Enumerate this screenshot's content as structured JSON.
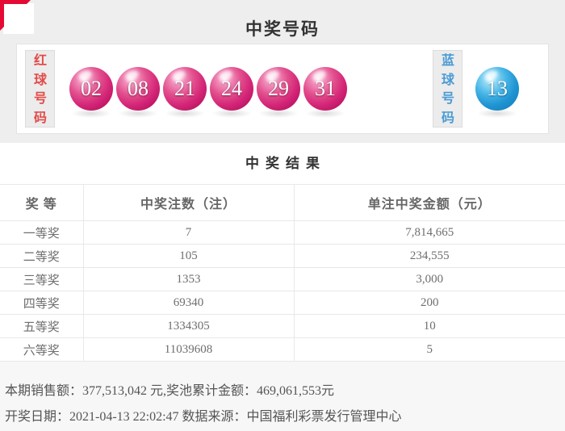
{
  "header": {
    "title": "中奖号码"
  },
  "balls": {
    "red_label": "红球号码",
    "blue_label": "蓝球号码",
    "red": [
      "02",
      "08",
      "21",
      "24",
      "29",
      "31"
    ],
    "blue_value": "13"
  },
  "colors": {
    "accent_corner_red": "#e50a33",
    "red_ball": "#d42577",
    "blue_ball": "#1f94d2",
    "red_label_text": "#e34a48",
    "blue_label_text": "#4a9bd5"
  },
  "results": {
    "title": "中奖结果"
  },
  "table": {
    "headers": [
      "奖 等",
      "中奖注数（注）",
      "单注中奖金额（元）"
    ],
    "rows": [
      {
        "tier": "一等奖",
        "count": "7",
        "amount": "7,814,665"
      },
      {
        "tier": "二等奖",
        "count": "105",
        "amount": "234,555"
      },
      {
        "tier": "三等奖",
        "count": "1353",
        "amount": "3,000"
      },
      {
        "tier": "四等奖",
        "count": "69340",
        "amount": "200"
      },
      {
        "tier": "五等奖",
        "count": "1334305",
        "amount": "10"
      },
      {
        "tier": "六等奖",
        "count": "11039608",
        "amount": "5"
      }
    ]
  },
  "footer": {
    "sales_line": "本期销售额：377,513,042 元,奖池累计金额：469,061,553元",
    "date_line": "开奖日期：2021-04-13 22:02:47 数据来源：中国福利彩票发行管理中心"
  }
}
